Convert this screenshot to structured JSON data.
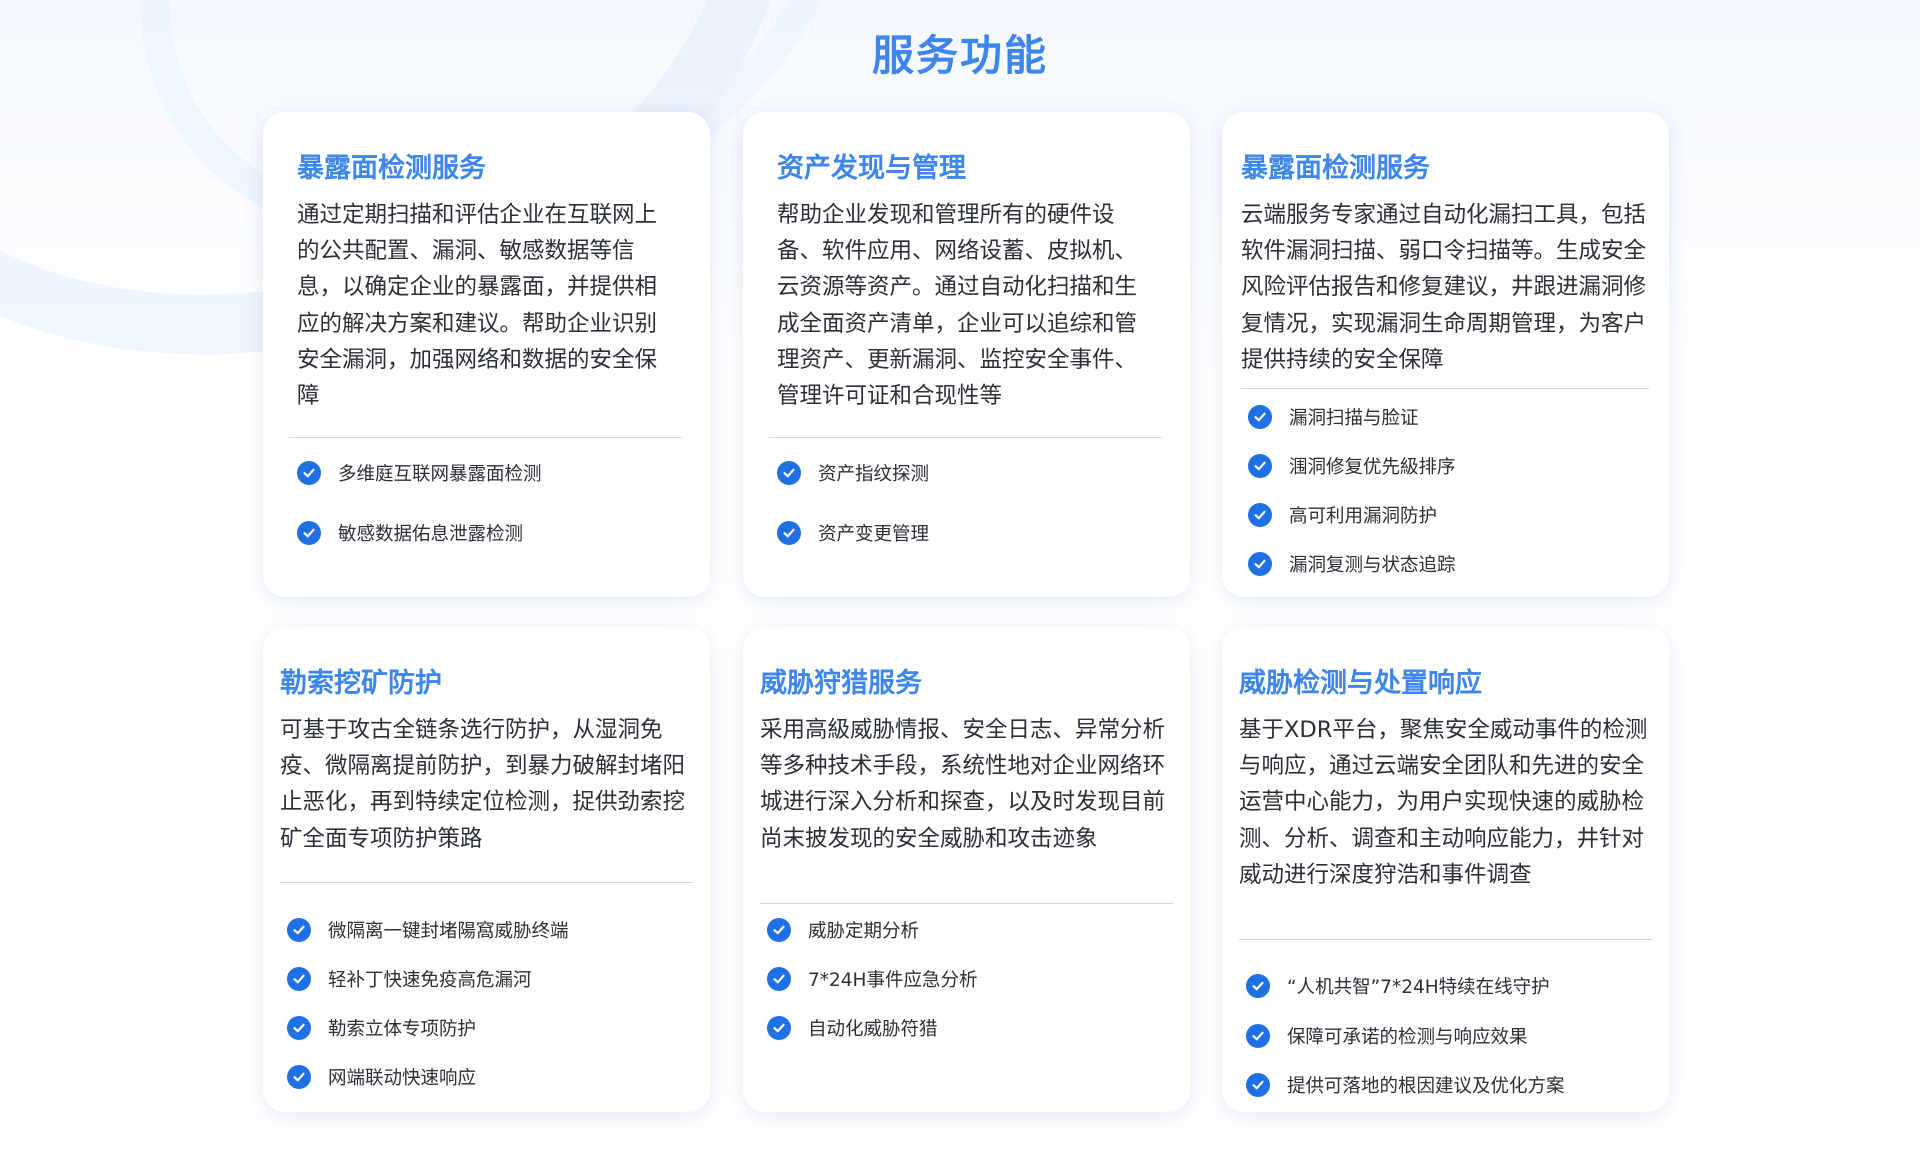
{
  "page_title": "服务功能",
  "cards": [
    {
      "title": "暴露面检测服务",
      "description": "通过定期扫描和评估企业在互联网上的公共配置、漏洞、敏感数据等信息，以确定企业的暴露面，并提供相应的解决方案和建议。帮助企业识别安全漏洞，加强网络和数据的安全保障",
      "features": [
        "多维庭互联网暴露面检测",
        "敏感数据佑息泄露检测"
      ]
    },
    {
      "title": "资产发现与管理",
      "description": "帮助企业发现和管理所有的硬件设备、软件应用、网络设蓄、皮拟机、云资源等资产。通过自动化扫描和生成全面资产清单，企业可以追综和管理资产、更新漏洞、监控安全事件、管理许可证和合现性等",
      "features": [
        "资产指纹探测",
        "资产变更管理"
      ]
    },
    {
      "title": "暴露面检测服务",
      "description": "云端服务专家通过自动化漏扫工具，包括软件漏洞扫描、弱口令扫描等。生成安全风险评估报告和修复建议，井跟进漏洞修复情况，实现漏洞生命周期管理，为客户提供持续的安全保障",
      "features": [
        "漏洞扫描与脸证",
        "涠洞修复优先級排序",
        "高可利用漏洞防护",
        "漏洞复测与状态追踪"
      ]
    },
    {
      "title": "勒索挖矿防护",
      "description": "可基于攻古全链条选行防护，从湿洞免疫、微隔离提前防护，到暴力破解封堵阳止恶化，再到特续定位检测，捉供劲索挖矿全面专项防护策路",
      "features": [
        "微隔离一键封堵陽窩威胁终端",
        "轻补丁快速免疫高危漏河",
        "勒索立体专项防护",
        "网端联动快速响应"
      ]
    },
    {
      "title": "威胁狩猎服务",
      "description": "采用高級威胁情报、安全日志、异常分析等多种技术手段，系统性地对企业网络环城进行深入分析和探查，以及时发现目前尚末披发现的安全威胁和攻击迹象",
      "features": [
        "威胁定期分析",
        "7*24H事件应急分析",
        "自动化威胁符猎"
      ]
    },
    {
      "title": "威胁检测与处置响应",
      "description": "基于XDR平台，聚焦安全威动事件的检测与响应，通过云端安全团队和先进的安全运营中心能力，为用户实现快速的威胁检测、分析、调查和主动响应能力，井针对威动进行深度狩浩和事件调查",
      "features": [
        "“人机共智”7*24H特续在线守护",
        "保障可承诺的检测与响应效果",
        "提供可落地的根因建议及优化方案"
      ]
    }
  ],
  "colors": {
    "accent": "#3f86ec",
    "check": "#1f6fe5",
    "text": "#2b2f38",
    "divider": "#d6d9de"
  },
  "icons": {
    "feature_bullet": "check-circle-icon"
  }
}
